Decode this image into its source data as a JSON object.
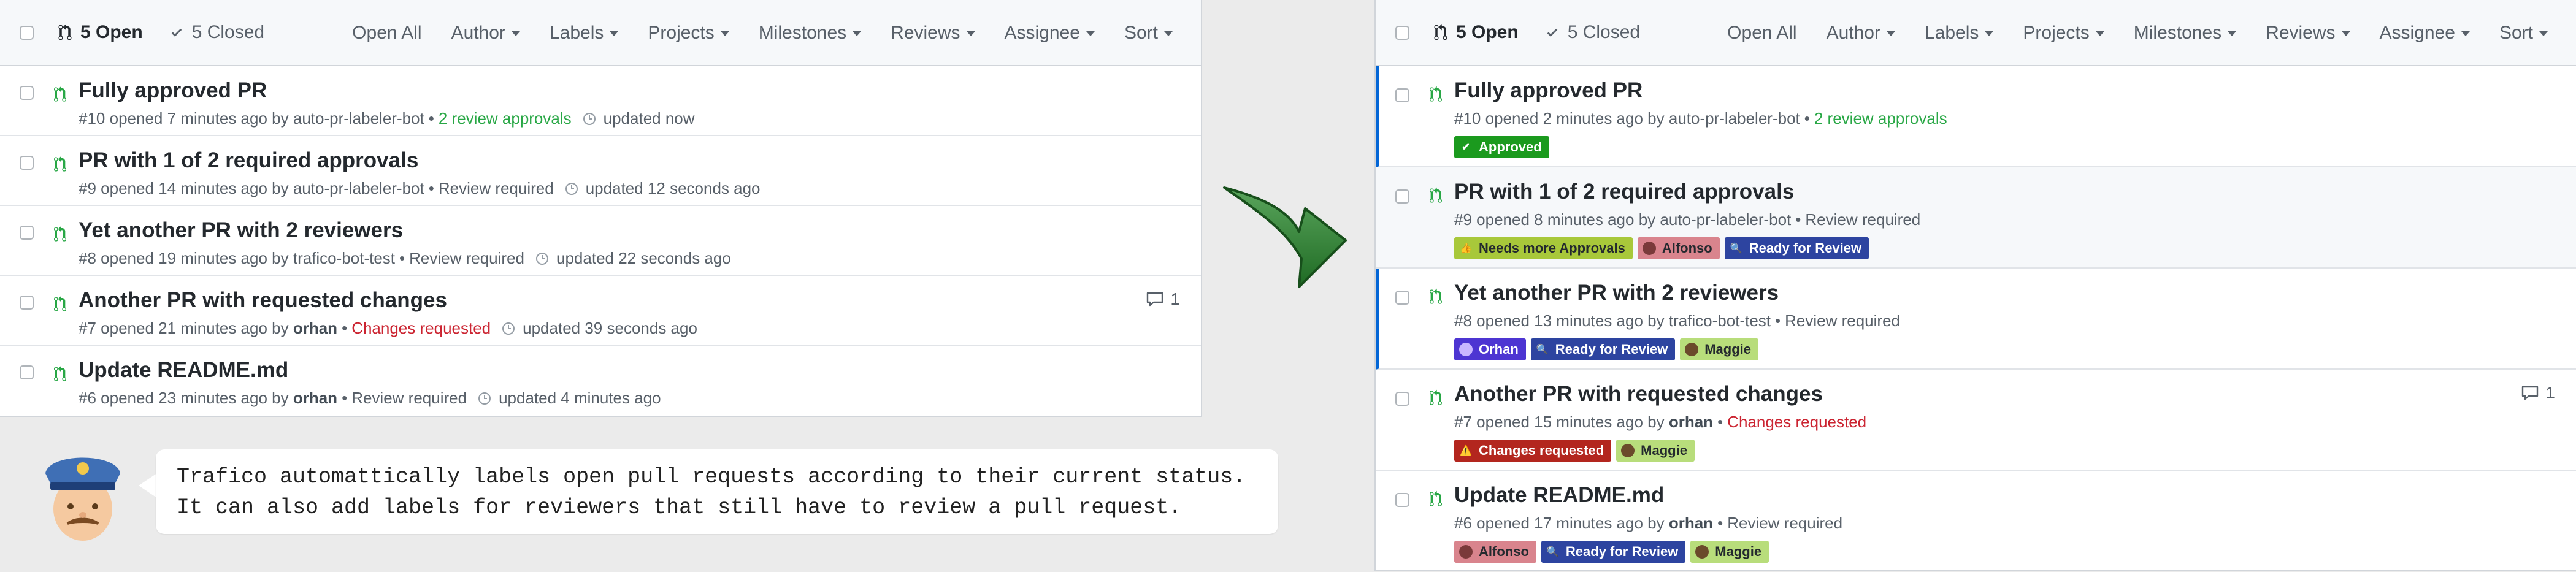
{
  "header": {
    "open_label": "5 Open",
    "closed_label": "5 Closed",
    "filters": [
      "Open All",
      "Author",
      "Labels",
      "Projects",
      "Milestones",
      "Reviews",
      "Assignee",
      "Sort"
    ]
  },
  "before": {
    "prs": [
      {
        "title": "Fully approved PR",
        "number": "#10",
        "opened": "opened 7 minutes ago by",
        "author": "auto-pr-labeler-bot",
        "status": "2 review approvals",
        "updated": "updated now"
      },
      {
        "title": "PR with 1 of 2 required approvals",
        "number": "#9",
        "opened": "opened 14 minutes ago by",
        "author": "auto-pr-labeler-bot",
        "status": "Review required",
        "updated": "updated 12 seconds ago"
      },
      {
        "title": "Yet another PR with 2 reviewers",
        "number": "#8",
        "opened": "opened 19 minutes ago by",
        "author": "trafico-bot-test",
        "status": "Review required",
        "updated": "updated 22 seconds ago"
      },
      {
        "title": "Another PR with requested changes",
        "number": "#7",
        "opened": "opened 21 minutes ago by",
        "author": "orhan",
        "status": "Changes requested",
        "updated": "updated 39 seconds ago",
        "comments": "1"
      },
      {
        "title": "Update README.md",
        "number": "#6",
        "opened": "opened 23 minutes ago by",
        "author": "orhan",
        "status": "Review required",
        "updated": "updated 4 minutes ago"
      }
    ]
  },
  "after": {
    "prs": [
      {
        "title": "Fully approved PR",
        "number": "#10",
        "opened": "opened 2 minutes ago by",
        "author": "auto-pr-labeler-bot",
        "status": "2 review approvals",
        "labels": [
          {
            "text": "Approved",
            "color": "#1b9a1e"
          }
        ]
      },
      {
        "title": "PR with 1 of 2 required approvals",
        "number": "#9",
        "opened": "opened 8 minutes ago by",
        "author": "auto-pr-labeler-bot",
        "status": "Review required",
        "labels": [
          {
            "text": "Needs more Approvals",
            "color": "#a8c83a"
          },
          {
            "text": "Alfonso",
            "color": "#d9848d"
          },
          {
            "text": "Ready for Review",
            "color": "#2d44a0"
          }
        ]
      },
      {
        "title": "Yet another PR with 2 reviewers",
        "number": "#8",
        "opened": "opened 13 minutes ago by",
        "author": "trafico-bot-test",
        "status": "Review required",
        "labels": [
          {
            "text": "Orhan",
            "color": "#4d35d2"
          },
          {
            "text": "Ready for Review",
            "color": "#2d44a0"
          },
          {
            "text": "Maggie",
            "color": "#b8dd7b"
          }
        ]
      },
      {
        "title": "Another PR with requested changes",
        "number": "#7",
        "opened": "opened 15 minutes ago by",
        "author": "orhan",
        "status": "Changes requested",
        "comments": "1",
        "labels": [
          {
            "text": "Changes requested",
            "color": "#b3261e"
          },
          {
            "text": "Maggie",
            "color": "#b8dd7b"
          }
        ]
      },
      {
        "title": "Update README.md",
        "number": "#6",
        "opened": "opened 17 minutes ago by",
        "author": "orhan",
        "status": "Review required",
        "labels": [
          {
            "text": "Alfonso",
            "color": "#d9848d"
          },
          {
            "text": "Ready for Review",
            "color": "#2d44a0"
          },
          {
            "text": "Maggie",
            "color": "#b8dd7b"
          }
        ]
      }
    ]
  },
  "bubble": {
    "line1": "Trafico automattically labels open pull requests according to their current status.",
    "line2": "It can also add labels for reviewers that still have to review a pull request."
  },
  "colors": {
    "open_pr_green": "#28a745",
    "changes_red": "#cb2431",
    "active_blue": "#0366d6",
    "arrow_green": "#2e7d32"
  }
}
